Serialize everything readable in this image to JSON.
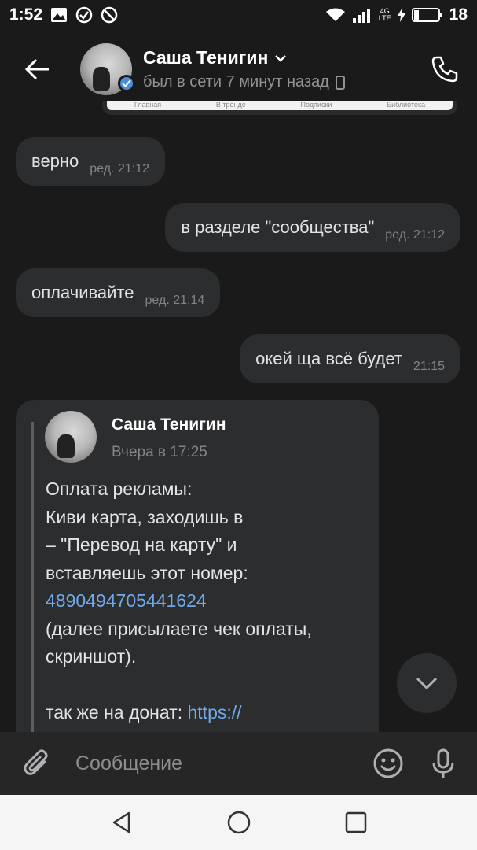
{
  "status_bar": {
    "time": "1:52",
    "network": "4G LTE",
    "battery": "18"
  },
  "header": {
    "name": "Саша Тенигин",
    "last_seen": "был в сети 7 минут назад"
  },
  "preview_tabs": [
    "Главная",
    "В тренде",
    "Подписки",
    "Библиотека"
  ],
  "messages": [
    {
      "direction": "in",
      "text": "верно",
      "meta": "ред. 21:12"
    },
    {
      "direction": "out",
      "text": "в разделе \"сообщества\"",
      "meta": "ред. 21:12"
    },
    {
      "direction": "in",
      "text": "оплачивайте",
      "meta": "ред. 21:14"
    },
    {
      "direction": "out",
      "text": "окей ща всё будет",
      "meta": "21:15"
    }
  ],
  "forwarded": {
    "name": "Саша Тенигин",
    "date": "Вчера в 17:25",
    "lines": [
      "Оплата рекламы:",
      "Киви карта, заходишь в",
      "– \"Перевод на карту\" и",
      "вставляешь этот номер:"
    ],
    "card_number": "4890494705441624",
    "lines2": [
      "(далее присылаете чек оплаты,",
      "скриншот)."
    ],
    "donate_prefix": "так же на донат: ",
    "donate_link": "https://"
  },
  "composer": {
    "placeholder": "Сообщение"
  },
  "colors": {
    "background": "#1a1a1b",
    "bubble": "#2c2d2e",
    "link": "#71aaeb",
    "verified": "#4a90d9"
  }
}
